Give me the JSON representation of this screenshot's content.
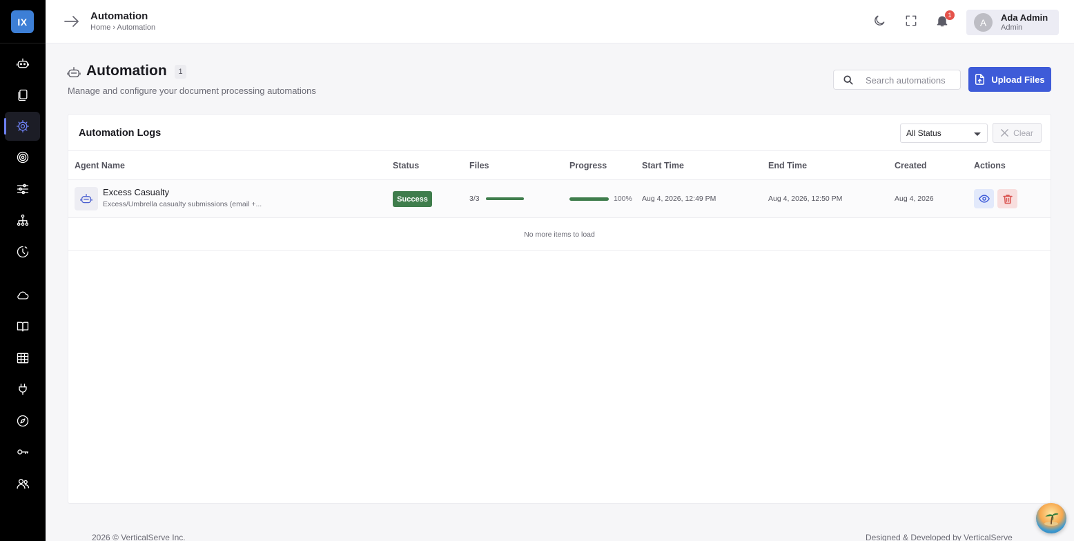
{
  "app": {
    "logo_text": "IX",
    "accent_color": "#3e5bd8",
    "sidebar_active_color": "#6c7ff0"
  },
  "sidebar": {
    "items": [
      {
        "icon": "robot-icon"
      },
      {
        "icon": "documents-icon"
      },
      {
        "icon": "gear-icon",
        "active": true
      },
      {
        "icon": "target-icon"
      },
      {
        "icon": "sliders-icon"
      },
      {
        "icon": "org-chart-icon"
      },
      {
        "icon": "history-clock-icon"
      },
      {
        "icon": "cloud-icon"
      },
      {
        "icon": "book-icon"
      },
      {
        "icon": "table-icon"
      },
      {
        "icon": "plug-icon"
      },
      {
        "icon": "compass-icon"
      },
      {
        "icon": "key-icon"
      },
      {
        "icon": "users-icon"
      }
    ]
  },
  "header": {
    "title": "Automation",
    "breadcrumb": "Home › Automation",
    "notification_count": "1",
    "user": {
      "initial": "A",
      "name": "Ada Admin",
      "role": "Admin"
    }
  },
  "page": {
    "title": "Automation",
    "count": "1",
    "subtitle": "Manage and configure your document processing automations",
    "search_placeholder": "Search automations",
    "upload_label": "Upload Files"
  },
  "logs": {
    "title": "Automation Logs",
    "status_filter": "All Status",
    "clear_label": "Clear",
    "columns": [
      "Agent Name",
      "Status",
      "Files",
      "Progress",
      "Start Time",
      "End Time",
      "Created",
      "Actions"
    ],
    "rows": [
      {
        "agent_name": "Excess Casualty",
        "description": "Excess/Umbrella casualty submissions (email +...",
        "status": "Success",
        "status_color": "#3f7d4c",
        "files": "3/3",
        "files_fraction": 1.0,
        "progress": "100%",
        "progress_fraction": 1.0,
        "start_time": "Aug 4, 2026, 12:49 PM",
        "end_time": "Aug 4, 2026, 12:50 PM",
        "created": "Aug 4, 2026"
      }
    ],
    "end_message": "No more items to load"
  },
  "footer": {
    "left": "2026 © VerticalServe Inc.",
    "right": "Designed & Developed by VerticalServe"
  }
}
